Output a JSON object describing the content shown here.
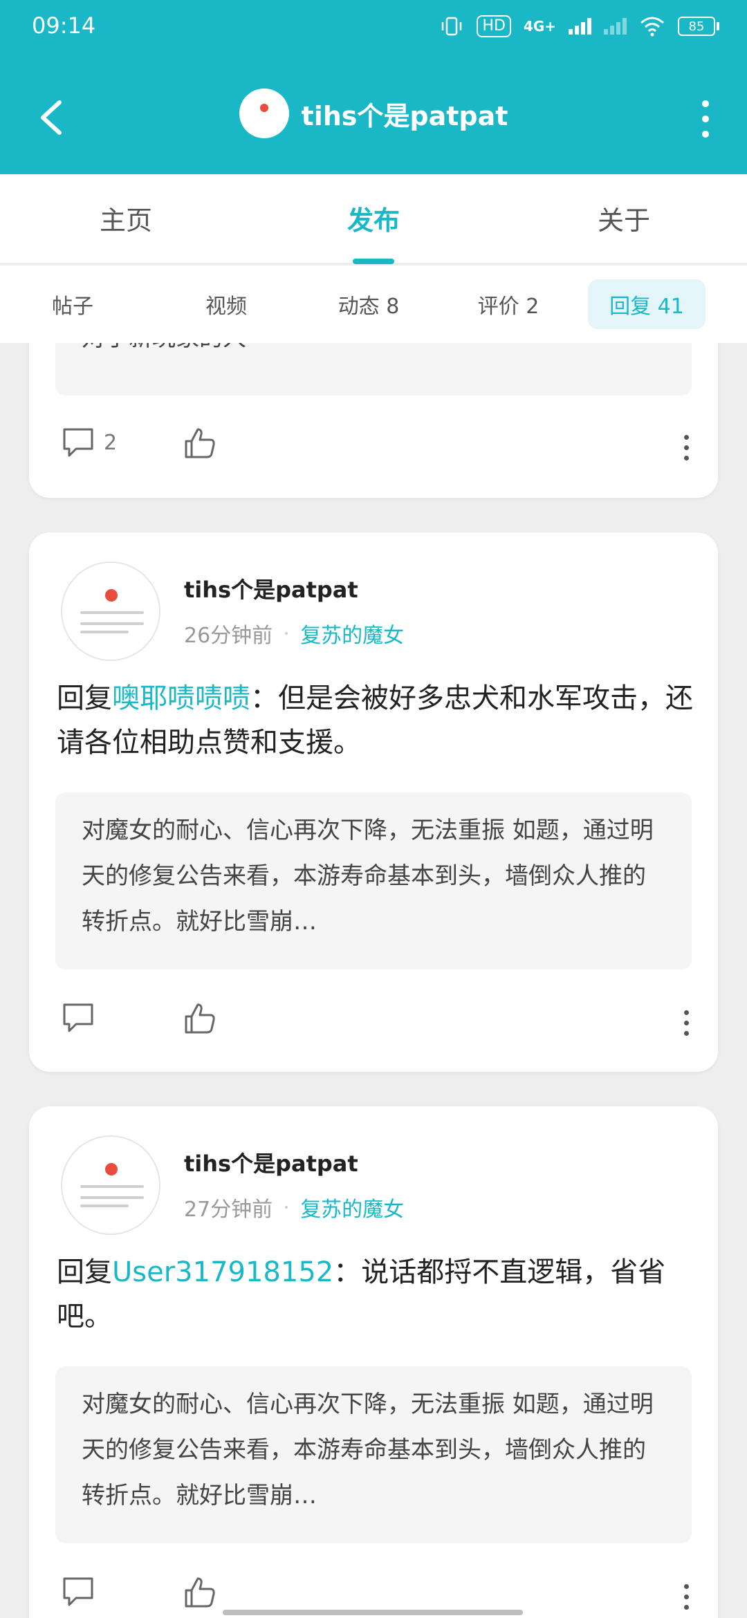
{
  "status_bar": {
    "time": "09:14",
    "hd": "HD",
    "network": "4G+",
    "battery": "85"
  },
  "header": {
    "title": "tihs个是patpat"
  },
  "main_tabs": [
    {
      "label": "主页",
      "active": false
    },
    {
      "label": "发布",
      "active": true
    },
    {
      "label": "关于",
      "active": false
    }
  ],
  "sub_tabs": [
    {
      "label": "帖子",
      "active": false
    },
    {
      "label": "视频",
      "active": false
    },
    {
      "label": "动态 8",
      "active": false
    },
    {
      "label": "评价 2",
      "active": false
    },
    {
      "label": "回复 41",
      "active": true
    }
  ],
  "cards": [
    {
      "partial": true,
      "quote_tail": "对于新玩家的人",
      "comments": "2"
    },
    {
      "author": "tihs个是patpat",
      "time": "26分钟前",
      "forum": "复苏的魔女",
      "reply_prefix": "回复",
      "mention": "噢耶啧啧啧",
      "reply_body": "：但是会被好多忠犬和水军攻击，还请各位相助点赞和支援。",
      "quote": "对魔女的耐心、信心再次下降，无法重振 如题，通过明天的修复公告来看，本游寿命基本到头，墙倒众人推的转折点。就好比雪崩…",
      "comments": ""
    },
    {
      "author": "tihs个是patpat",
      "time": "27分钟前",
      "forum": "复苏的魔女",
      "reply_prefix": "回复",
      "mention": "User317918152",
      "reply_body": "：说话都捋不直逻辑，省省吧。",
      "quote": "对魔女的耐心、信心再次下降，无法重振 如题，通过明天的修复公告来看，本游寿命基本到头，墙倒众人推的转折点。就好比雪崩…",
      "comments": ""
    }
  ],
  "colors": {
    "accent": "#1ab8c7",
    "background": "#eeeeee"
  }
}
